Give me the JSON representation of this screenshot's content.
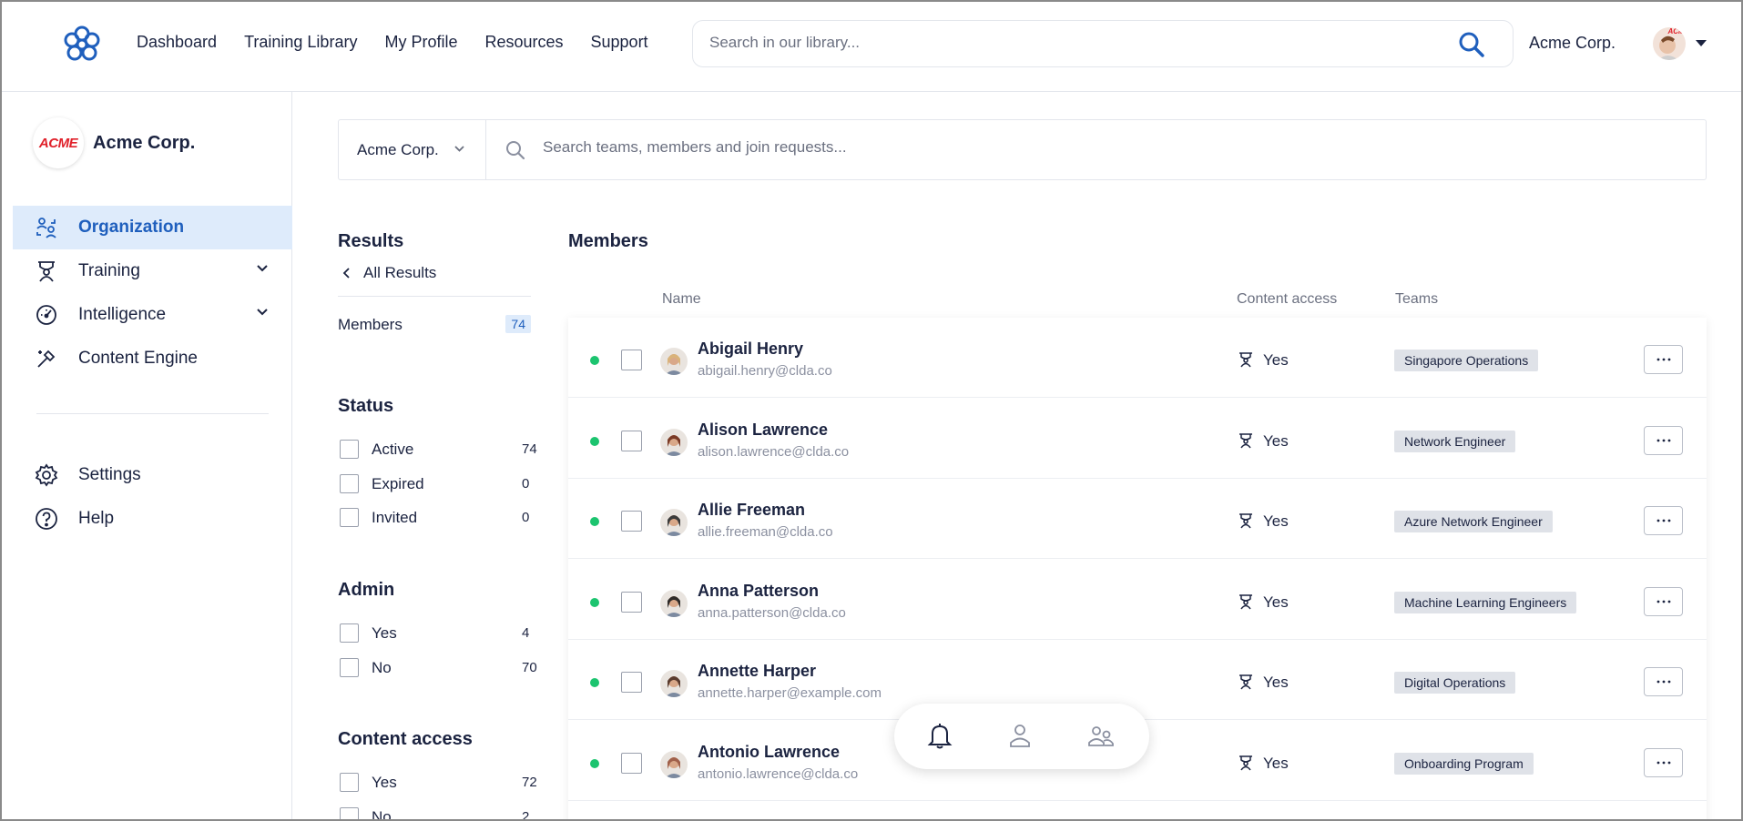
{
  "topnav": {
    "items": [
      "Dashboard",
      "Training Library",
      "My Profile",
      "Resources",
      "Support"
    ],
    "search_placeholder": "Search in our library...",
    "org_name": "Acme Corp.",
    "avatar_mark": "ACME"
  },
  "sidebar": {
    "org_logo_text": "ACME",
    "org_name": "Acme Corp.",
    "items": [
      {
        "label": "Organization",
        "icon": "organization-icon",
        "active": true
      },
      {
        "label": "Training",
        "icon": "training-icon",
        "expandable": true
      },
      {
        "label": "Intelligence",
        "icon": "gauge-icon",
        "expandable": true
      },
      {
        "label": "Content Engine",
        "icon": "wand-icon"
      },
      {
        "label": "Settings",
        "icon": "gear-icon"
      },
      {
        "label": "Help",
        "icon": "help-icon"
      }
    ]
  },
  "filterbar": {
    "org_select": "Acme Corp.",
    "search_placeholder": "Search teams, members and join requests..."
  },
  "filters": {
    "results_title": "Results",
    "back_label": "All Results",
    "members_label": "Members",
    "members_count": "74",
    "status": {
      "title": "Status",
      "options": [
        {
          "label": "Active",
          "count": "74"
        },
        {
          "label": "Expired",
          "count": "0"
        },
        {
          "label": "Invited",
          "count": "0"
        }
      ]
    },
    "admin": {
      "title": "Admin",
      "options": [
        {
          "label": "Yes",
          "count": "4"
        },
        {
          "label": "No",
          "count": "70"
        }
      ]
    },
    "content_access": {
      "title": "Content access",
      "options": [
        {
          "label": "Yes",
          "count": "72"
        },
        {
          "label": "No",
          "count": "2"
        }
      ]
    }
  },
  "members": {
    "title": "Members",
    "columns": {
      "name": "Name",
      "content_access": "Content access",
      "teams": "Teams"
    },
    "rows": [
      {
        "name": "Abigail Henry",
        "email": "abigail.henry@clda.co",
        "access": "Yes",
        "team": "Singapore Operations",
        "avatar_color": "#d9b37a"
      },
      {
        "name": "Alison Lawrence",
        "email": "alison.lawrence@clda.co",
        "access": "Yes",
        "team": "Network Engineer",
        "avatar_color": "#7a3a26"
      },
      {
        "name": "Allie Freeman",
        "email": "allie.freeman@clda.co",
        "access": "Yes",
        "team": "Azure Network Engineer",
        "avatar_color": "#3b3b3b"
      },
      {
        "name": "Anna Patterson",
        "email": "anna.patterson@clda.co",
        "access": "Yes",
        "team": "Machine Learning Engineers",
        "avatar_color": "#2e2a28"
      },
      {
        "name": "Annette Harper",
        "email": "annette.harper@example.com",
        "access": "Yes",
        "team": "Digital Operations",
        "avatar_color": "#5a3b2e"
      },
      {
        "name": "Antonio Lawrence",
        "email": "antonio.lawrence@clda.co",
        "access": "Yes",
        "team": "Onboarding Program",
        "avatar_color": "#a0604a"
      }
    ]
  },
  "colors": {
    "accent": "#1f5fbd",
    "active_bg": "#deebfb",
    "status_active": "#1cc46f",
    "text": "#1b2340"
  }
}
